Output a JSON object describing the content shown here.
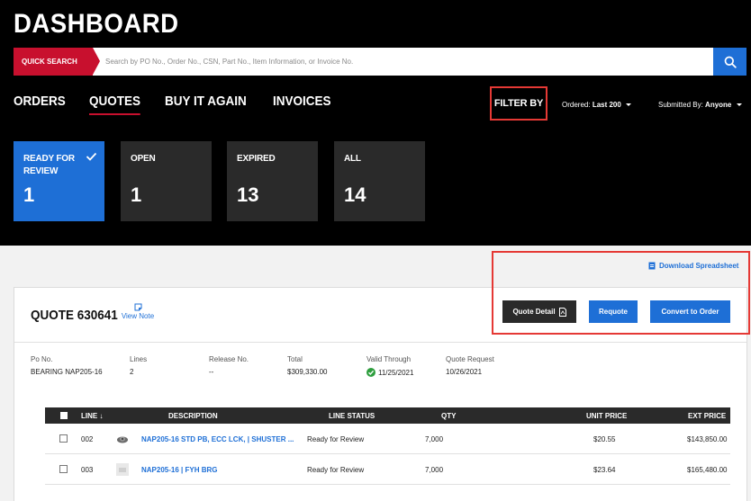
{
  "header": {
    "title": "DASHBOARD"
  },
  "search": {
    "tag": "QUICK SEARCH",
    "placeholder": "Search by PO No., Order No., CSN, Part No., Item Information, or Invoice No."
  },
  "nav": {
    "items": [
      "ORDERS",
      "QUOTES",
      "BUY IT AGAIN",
      "INVOICES"
    ],
    "active": "QUOTES"
  },
  "filter": {
    "label": "FILTER BY",
    "ordered_label": "Ordered:",
    "ordered_value": "Last 200",
    "submitted_label": "Submitted By:",
    "submitted_value": "Anyone"
  },
  "status_cards": [
    {
      "label": "READY FOR REVIEW",
      "count": "1",
      "active": true
    },
    {
      "label": "OPEN",
      "count": "1",
      "active": false
    },
    {
      "label": "EXPIRED",
      "count": "13",
      "active": false
    },
    {
      "label": "ALL",
      "count": "14",
      "active": false
    }
  ],
  "download": {
    "label": "Download Spreadsheet"
  },
  "quote": {
    "title": "QUOTE 630641",
    "view_note": "View Note",
    "buttons": {
      "detail": "Quote Detail",
      "requote": "Requote",
      "convert": "Convert to Order"
    },
    "meta": [
      {
        "label": "Po No.",
        "value": "BEARING NAP205-16"
      },
      {
        "label": "Lines",
        "value": "2"
      },
      {
        "label": "Release No.",
        "value": "--"
      },
      {
        "label": "Total",
        "value": "$309,330.00"
      },
      {
        "label": "Valid Through",
        "value": "11/25/2021"
      },
      {
        "label": "Quote Request",
        "value": "10/26/2021"
      }
    ]
  },
  "table": {
    "headers": {
      "line": "LINE",
      "description": "DESCRIPTION",
      "status": "LINE STATUS",
      "qty": "QTY",
      "unit_price": "UNIT PRICE",
      "ext_price": "EXT PRICE"
    },
    "rows": [
      {
        "line": "002",
        "description": "NAP205-16 STD PB, ECC LCK, | SHUSTER ...",
        "status": "Ready for Review",
        "qty": "7,000",
        "unit_price": "$20.55",
        "ext_price": "$143,850.00"
      },
      {
        "line": "003",
        "description": "NAP205-16 | FYH BRG",
        "status": "Ready for Review",
        "qty": "7,000",
        "unit_price": "$23.64",
        "ext_price": "$165,480.00"
      }
    ]
  },
  "colors": {
    "brand_red": "#c8102e",
    "accent_blue": "#1e6fd6",
    "highlight_red": "#e53935",
    "valid_green": "#2e9e3e"
  }
}
